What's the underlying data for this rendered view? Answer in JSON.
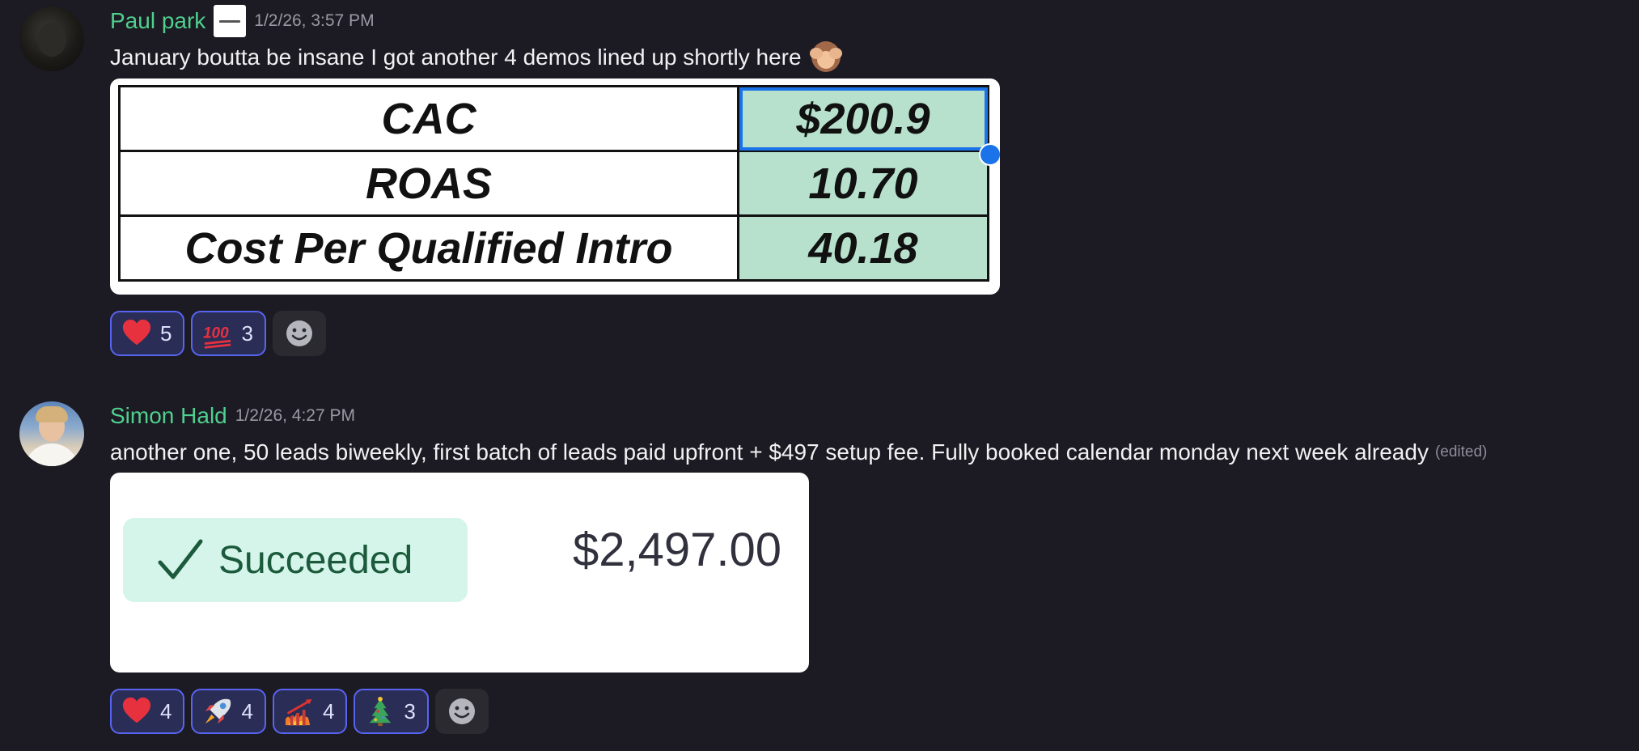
{
  "messages": [
    {
      "username": "Paul park",
      "timestamp": "1/2/26, 3:57 PM",
      "text": "January boutta be insane I got another 4 demos lined up shortly here",
      "table": [
        {
          "label": "CAC",
          "value": "$200.9"
        },
        {
          "label": "ROAS",
          "value": "10.70"
        },
        {
          "label": "Cost Per Qualified Intro",
          "value": "40.18"
        }
      ],
      "reactions": [
        {
          "icon": "heart-icon",
          "count": "5"
        },
        {
          "icon": "hundred-points-icon",
          "count": "3"
        }
      ]
    },
    {
      "username": "Simon Hald",
      "timestamp": "1/2/26, 4:27 PM",
      "text": "another one, 50 leads biweekly, first batch of leads paid upfront + $497 setup fee. Fully booked calendar monday next week already",
      "edited": "(edited)",
      "payment": {
        "status": "Succeeded",
        "amount": "$2,497.00"
      },
      "reactions": [
        {
          "icon": "heart-icon",
          "count": "4"
        },
        {
          "icon": "rocket-icon",
          "count": "4"
        },
        {
          "icon": "chart-fire-icon",
          "count": "4"
        },
        {
          "icon": "christmas-tree-icon",
          "count": "3"
        }
      ]
    }
  ],
  "colors": {
    "background": "#1c1a22",
    "username": "#4fd08e",
    "reaction_border": "#5865f2",
    "sheet_value_fill": "#b7e1cd",
    "success_badge": "#d5f5ea"
  }
}
